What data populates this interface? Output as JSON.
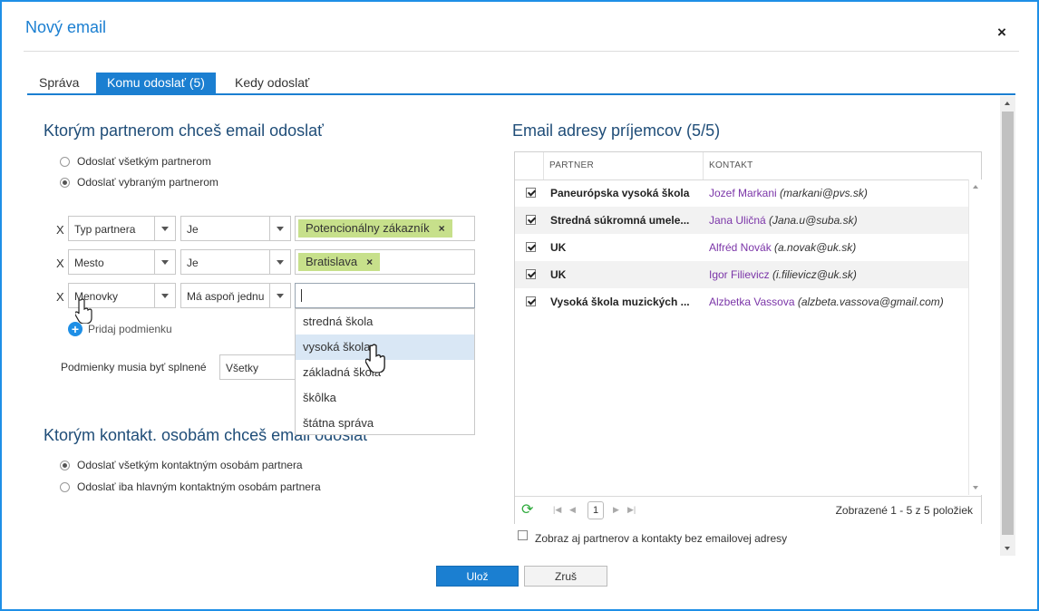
{
  "dialog": {
    "title": "Nový email",
    "close": "×"
  },
  "tabs": [
    {
      "label": "Správa",
      "active": false
    },
    {
      "label": "Komu odoslať (5)",
      "active": true
    },
    {
      "label": "Kedy odoslať",
      "active": false
    }
  ],
  "partners": {
    "heading": "Ktorým partnerom chceš email odoslať",
    "options": [
      {
        "label": "Odoslať všetkým partnerom",
        "selected": false
      },
      {
        "label": "Odoslať vybraným partnerom",
        "selected": true
      }
    ],
    "conditions": [
      {
        "remove": "X",
        "field": "Typ partnera",
        "operator": "Je",
        "values": [
          "Potencionálny zákazník"
        ]
      },
      {
        "remove": "X",
        "field": "Mesto",
        "operator": "Je",
        "values": [
          "Bratislava"
        ]
      },
      {
        "remove": "X",
        "field": "Menovky",
        "operator": "Má aspoň jednu",
        "values": [],
        "input_value": ""
      }
    ],
    "dropdown_options": [
      "stredná škola",
      "vysoká škola",
      "základná škola",
      "škôlka",
      "štátna správa"
    ],
    "dropdown_highlighted": "vysoká škola",
    "add_condition": "Pridaj podmienku",
    "must_be_met_label": "Podmienky musia byť splnené",
    "must_be_met_value": "Všetky",
    "tag_remove": "×"
  },
  "contacts": {
    "heading": "Ktorým kontakt. osobám chceš email odoslať",
    "options": [
      {
        "label": "Odoslať všetkým kontaktným osobám partnera",
        "selected": true
      },
      {
        "label": "Odoslať iba hlavným kontaktným osobám partnera",
        "selected": false
      }
    ]
  },
  "recipients": {
    "heading": "Email adresy príjemcov (5/5)",
    "columns": [
      "PARTNER",
      "KONTAKT"
    ],
    "rows": [
      {
        "checked": true,
        "partner": "Paneurópska vysoká škola",
        "contact": "Jozef Markani",
        "email": "(markani@pvs.sk)"
      },
      {
        "checked": true,
        "partner": "Stredná súkromná umele...",
        "contact": "Jana Uličná",
        "email": "(Jana.u@suba.sk)"
      },
      {
        "checked": true,
        "partner": "UK",
        "contact": "Alfréd Novák",
        "email": "(a.novak@uk.sk)"
      },
      {
        "checked": true,
        "partner": "UK",
        "contact": "Igor Filievicz",
        "email": "(i.filievicz@uk.sk)"
      },
      {
        "checked": true,
        "partner": "Vysoká škola muzických ...",
        "contact": "Alzbetka Vassova",
        "email": "(alzbeta.vassova@gmail.com)"
      }
    ],
    "pager": {
      "page": "1",
      "info": "Zobrazené 1 - 5 z 5 položiek",
      "refresh": "⟳"
    },
    "show_without_email_label": "Zobraz aj partnerov a kontakty bez emailovej adresy"
  },
  "buttons": {
    "save": "Ulož",
    "cancel": "Zruš"
  },
  "icons": {
    "close": "close-icon",
    "dropdown": "chevron-down-icon",
    "add": "plus-circle-icon",
    "refresh": "refresh-icon",
    "pointer": "hand-pointer-icon",
    "pager": [
      "first-page-icon",
      "prev-page-icon",
      "next-page-icon",
      "last-page-icon"
    ]
  },
  "colors": {
    "accent": "#1b7fd1",
    "tag": "#c7e08b",
    "contact_name": "#7b35a8",
    "heading": "#1f4d78",
    "refresh": "#2eaa3c"
  }
}
